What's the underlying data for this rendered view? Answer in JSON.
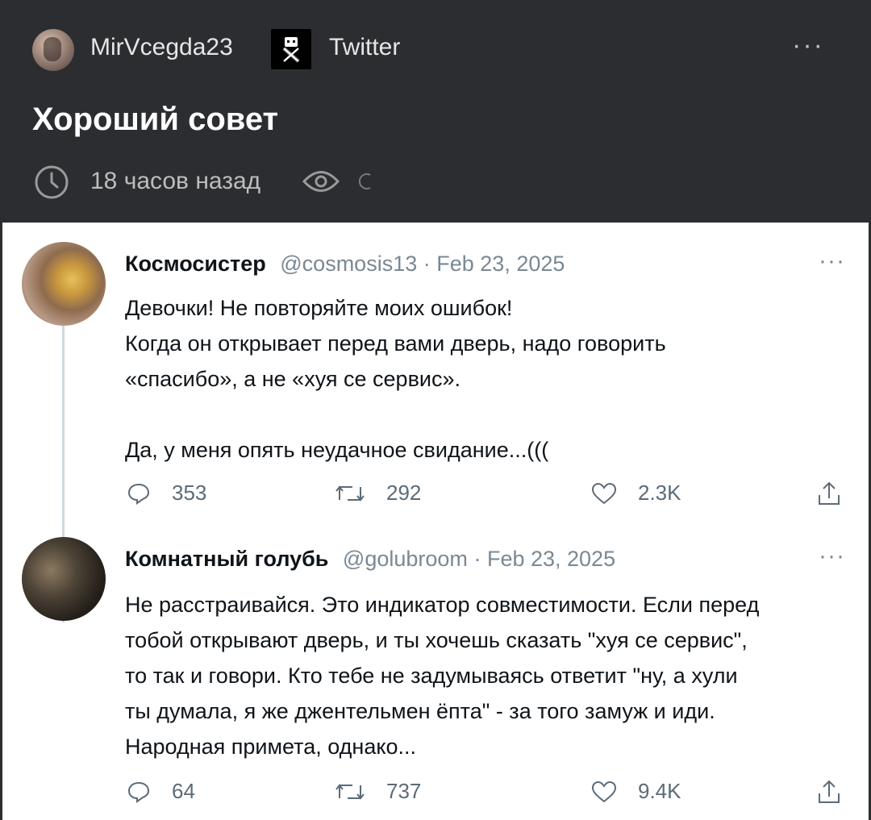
{
  "header": {
    "username": "MirVcegda23",
    "source": "Twitter",
    "more": "···",
    "title": "Хороший совет",
    "time": "18 часов назад"
  },
  "tweets": [
    {
      "name": "Космосистер",
      "handle": "@cosmosis13",
      "sep": "·",
      "date": "Feb 23, 2025",
      "more": "···",
      "lines": [
        "Девочки! Не повторяйте моих ошибок!",
        "Когда он открывает перед вами дверь, надо говорить",
        "«спасибо», а не «хуя се сервис».",
        "",
        "Да, у меня опять неудачное свидание...((("
      ],
      "replies": "353",
      "retweets": "292",
      "likes": "2.3K"
    },
    {
      "name": "Комнатный голубь",
      "handle": "@golubroom",
      "sep": "·",
      "date": "Feb 23, 2025",
      "more": "···",
      "lines": [
        "Не расстраивайся. Это индикатор совместимости. Если перед",
        "тобой открывают дверь, и ты хочешь сказать \"хуя се сервис\",",
        "то так и говори. Кто тебе не задумываясь ответит \"ну, а хули",
        "ты думала, я же джентельмен ёпта\" - за того замуж и иди.",
        "Народная примета, однако..."
      ],
      "replies": "64",
      "retweets": "737",
      "likes": "9.4K"
    }
  ],
  "icons": {
    "avatar": "user-avatar",
    "source_logo": "x-logo-icon",
    "clock": "clock-icon",
    "views": "eye-icon",
    "reply": "reply-icon",
    "retweet": "retweet-icon",
    "like": "heart-icon",
    "share": "share-icon"
  },
  "colors": {
    "header_bg": "#2b2d31",
    "card_bg": "#ffffff",
    "text_primary": "#0f1419",
    "text_secondary": "#5b6b78"
  }
}
